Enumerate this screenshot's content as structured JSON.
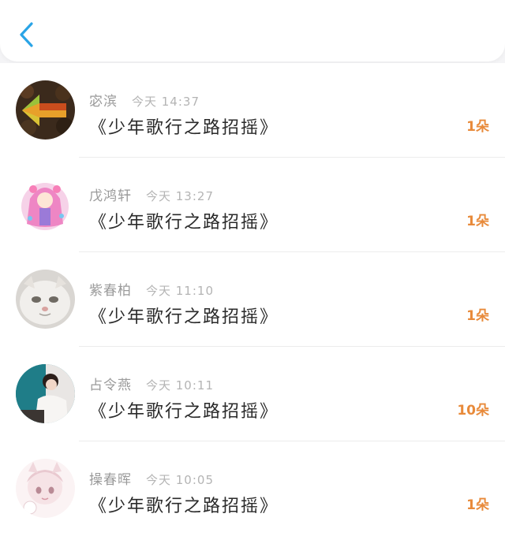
{
  "colors": {
    "accent": "#2aa4e6",
    "amount": "#e88a3a",
    "name": "#9a9a9a",
    "time": "#b4b4b4",
    "title": "#2a2a2a"
  },
  "header": {
    "back_icon": "chevron-left-icon"
  },
  "records": [
    {
      "name": "宓滨",
      "time": "今天 14:37",
      "title": "《少年歌行之路招摇》",
      "amount": "1朵"
    },
    {
      "name": "戊鸿轩",
      "time": "今天 13:27",
      "title": "《少年歌行之路招摇》",
      "amount": "1朵"
    },
    {
      "name": "紫春柏",
      "time": "今天 11:10",
      "title": "《少年歌行之路招摇》",
      "amount": "1朵"
    },
    {
      "name": "占令燕",
      "time": "今天 10:11",
      "title": "《少年歌行之路招摇》",
      "amount": "10朵"
    },
    {
      "name": "操春晖",
      "time": "今天 10:05",
      "title": "《少年歌行之路招摇》",
      "amount": "1朵"
    }
  ]
}
